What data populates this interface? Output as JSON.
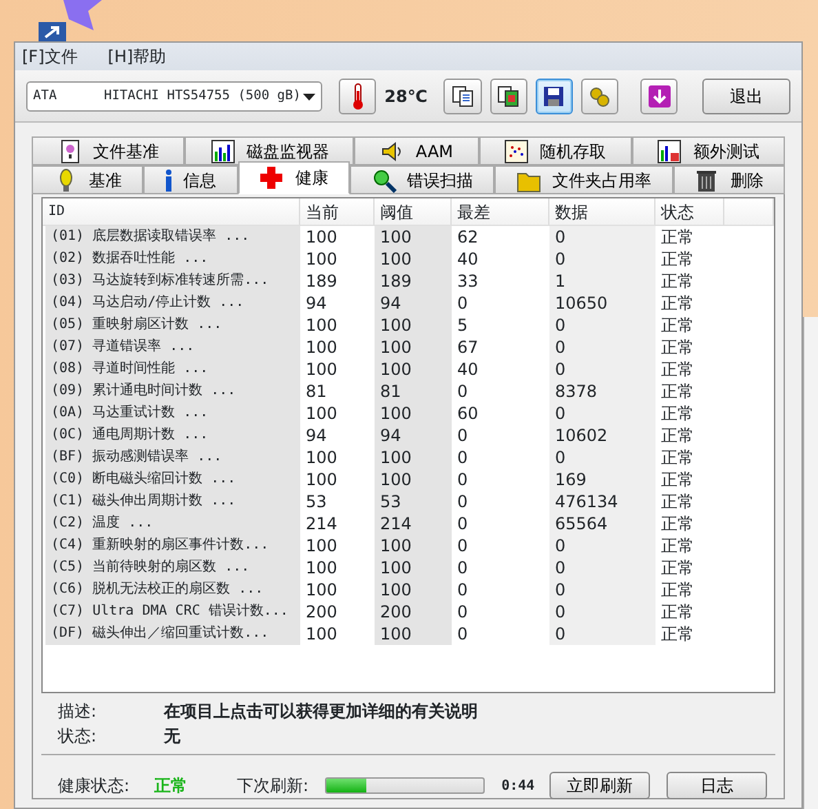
{
  "menu": [
    {
      "label": "[F]文件"
    },
    {
      "label": "[H]帮助"
    }
  ],
  "toolbar": {
    "drive": "ATA      HITACHI HTS54755 (500 gB)",
    "temperature": "28℃",
    "tools": [
      {
        "kind": "copy",
        "active": false
      },
      {
        "kind": "copy-color",
        "active": false
      },
      {
        "kind": "save",
        "active": true
      },
      {
        "kind": "tools",
        "active": false
      },
      {
        "kind": "download",
        "active": false
      }
    ],
    "exit": "退出"
  },
  "tab_rows": [
    [
      {
        "label": "文件基准",
        "kind": "file",
        "selected": false
      },
      {
        "label": "磁盘监视器",
        "kind": "chart",
        "selected": false
      },
      {
        "label": "AAM",
        "kind": "speaker",
        "selected": false
      },
      {
        "label": "随机存取",
        "kind": "dots",
        "selected": false
      },
      {
        "label": "额外测试",
        "kind": "chart2",
        "selected": false
      }
    ],
    [
      {
        "label": "基准",
        "kind": "bulb",
        "selected": false
      },
      {
        "label": "信息",
        "kind": "info",
        "selected": false
      },
      {
        "label": "健康",
        "kind": "cross",
        "selected": true
      },
      {
        "label": "错误扫描",
        "kind": "magnifier",
        "selected": false
      },
      {
        "label": "文件夹占用率",
        "kind": "folder",
        "selected": false
      },
      {
        "label": "删除",
        "kind": "trash",
        "selected": false
      }
    ]
  ],
  "table": {
    "columns": [
      "ID",
      "当前",
      "阈值",
      "最差",
      "数据",
      "状态"
    ],
    "rows": [
      [
        "(01) 底层数据读取错误率 ...",
        "100",
        "100",
        "62",
        "0",
        "正常"
      ],
      [
        "(02) 数据吞吐性能 ...",
        "100",
        "100",
        "40",
        "0",
        "正常"
      ],
      [
        "(03) 马达旋转到标准转速所需...",
        "189",
        "189",
        "33",
        "1",
        "正常"
      ],
      [
        "(04) 马达启动/停止计数 ...",
        "94",
        "94",
        "0",
        "10650",
        "正常"
      ],
      [
        "(05) 重映射扇区计数 ...",
        "100",
        "100",
        "5",
        "0",
        "正常"
      ],
      [
        "(07) 寻道错误率 ...",
        "100",
        "100",
        "67",
        "0",
        "正常"
      ],
      [
        "(08) 寻道时间性能 ...",
        "100",
        "100",
        "40",
        "0",
        "正常"
      ],
      [
        "(09) 累计通电时间计数 ...",
        "81",
        "81",
        "0",
        "8378",
        "正常"
      ],
      [
        "(0A) 马达重试计数 ...",
        "100",
        "100",
        "60",
        "0",
        "正常"
      ],
      [
        "(0C) 通电周期计数 ...",
        "94",
        "94",
        "0",
        "10602",
        "正常"
      ],
      [
        "(BF) 振动感测错误率 ...",
        "100",
        "100",
        "0",
        "0",
        "正常"
      ],
      [
        "(C0) 断电磁头缩回计数 ...",
        "100",
        "100",
        "0",
        "169",
        "正常"
      ],
      [
        "(C1) 磁头伸出周期计数 ...",
        "53",
        "53",
        "0",
        "476134",
        "正常"
      ],
      [
        "(C2) 温度 ...",
        "214",
        "214",
        "0",
        "65564",
        "正常"
      ],
      [
        "(C4) 重新映射的扇区事件计数...",
        "100",
        "100",
        "0",
        "0",
        "正常"
      ],
      [
        "(C5) 当前待映射的扇区数 ...",
        "100",
        "100",
        "0",
        "0",
        "正常"
      ],
      [
        "(C6) 脱机无法校正的扇区数 ...",
        "100",
        "100",
        "0",
        "0",
        "正常"
      ],
      [
        "(C7) Ultra DMA CRC 错误计数...",
        "200",
        "200",
        "0",
        "0",
        "正常"
      ],
      [
        "(DF) 磁头伸出／缩回重试计数...",
        "100",
        "100",
        "0",
        "0",
        "正常"
      ]
    ]
  },
  "details": [
    {
      "label": "描述:",
      "value": "在项目上点击可以获得更加详细的有关说明"
    },
    {
      "label": "状态:",
      "value": "无"
    }
  ],
  "status": {
    "health_label": "健康状态:",
    "health": "正常",
    "refresh_label": "下次刷新:",
    "level": 0.25,
    "countdown": "0:44",
    "buttons": [
      "立即刷新",
      "日志"
    ]
  }
}
